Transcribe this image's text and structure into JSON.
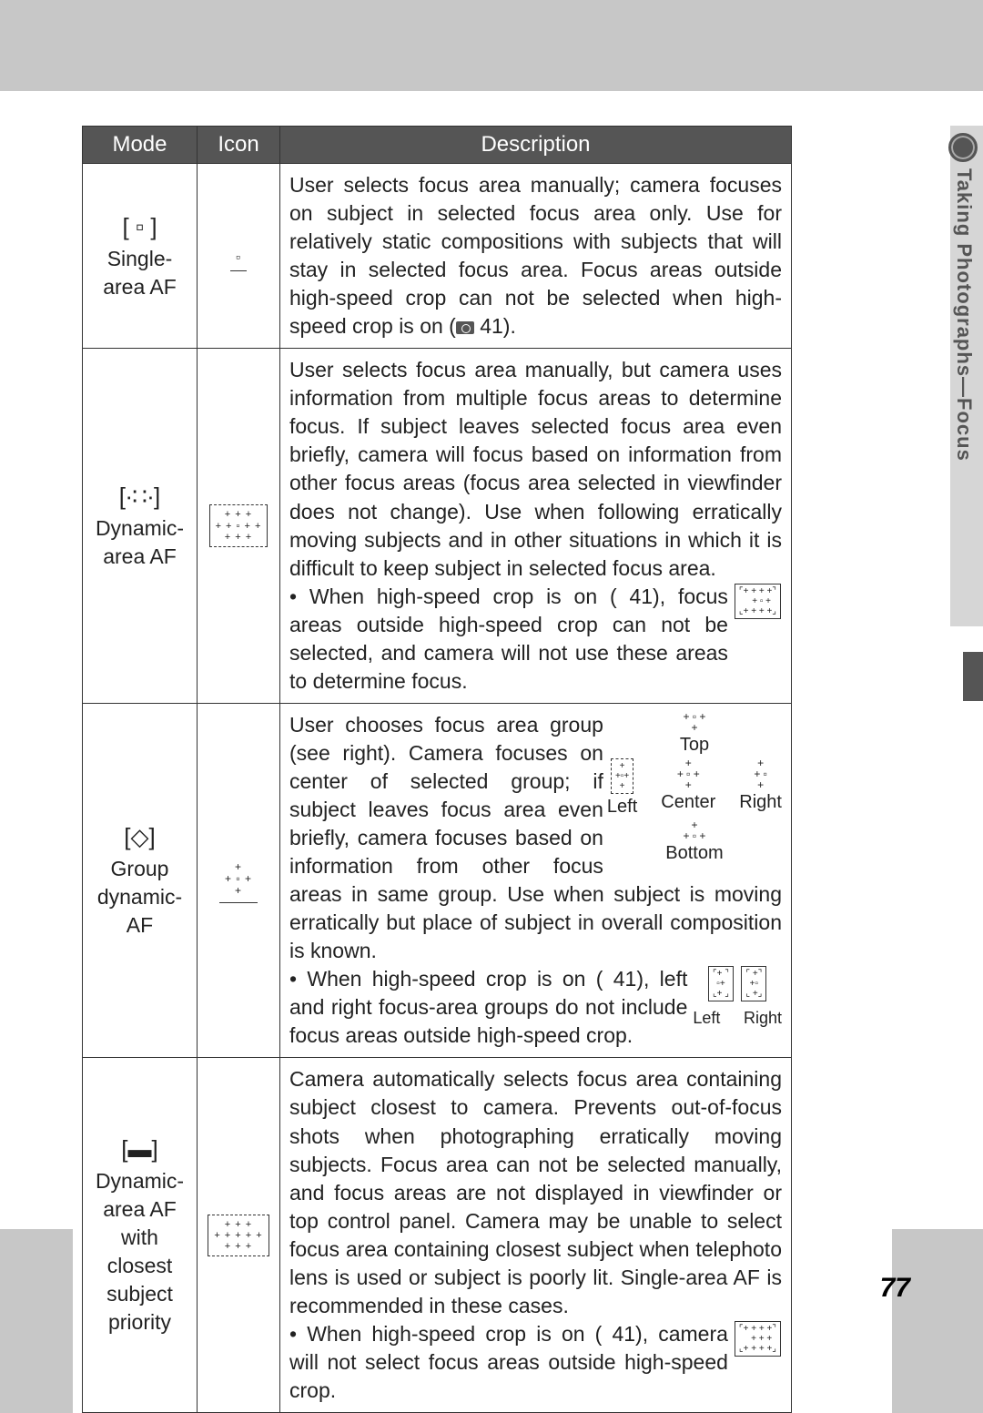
{
  "side": {
    "section_icon": "camera-dial-icon",
    "label": "Taking Photographs—Focus"
  },
  "table": {
    "headers": {
      "mode": "Mode",
      "icon": "Icon",
      "desc": "Description"
    },
    "rows": [
      {
        "mode_glyph": "[ ▫ ]",
        "mode_label": "Single-area AF",
        "icon_art": "▫",
        "desc_main": "User selects focus area manually; camera focuses on subject in selected focus area only.  Use for relatively static compositions with subjects that will stay in selected focus area.  Focus areas outside high-speed crop can not be selected when high-speed crop is on (",
        "desc_ref": " 41)."
      },
      {
        "mode_glyph": "[∙∷∙]",
        "mode_label": "Dynamic-area AF",
        "icon_art": "+ + +\n+ + ▫ + +\n+ + +",
        "desc_main": "User selects focus area manually, but camera uses information from multiple focus areas to determine focus.  If subject leaves selected focus area even briefly, camera will focus based on information from other focus areas (focus area selected in viewfinder does not change).  Use when following erratically moving subjects and in other situations in which it is difficult to keep subject in selected focus area.",
        "bullet_text": "When high-speed crop is on ( 41), focus areas outside high-speed crop can not be selected, and camera will not use these areas to determine focus.",
        "bullet_fig": "⌜+ + + +⌝\n   + ▫ +\n⌞+ + + +⌟"
      },
      {
        "mode_glyph": "[◇]",
        "mode_label": "Group dynamic-AF",
        "icon_art": "+\n+ ▫ +\n+",
        "desc_main": "User chooses focus area group (see right).  Camera focuses on center of selected group; if subject leaves focus area even briefly, camera focuses based on information from other focus areas in same group.  Use when subject is moving erratically but place of subject in overall composition is known.",
        "diagram": {
          "top": "Top",
          "left": "Left",
          "center": "Center",
          "right": "Right",
          "bottom": "Bottom"
        },
        "bullet_text": "When high-speed crop is on ( 41), left and right focus-area groups do not include focus areas outside high-speed crop.",
        "bullet_fig_labels": {
          "left": "Left",
          "right": "Right"
        }
      },
      {
        "mode_glyph": "[▬]",
        "mode_label": "Dynamic-area AF with closest subject priority",
        "icon_art": "+ + +\n+ + + + +\n+ + +",
        "desc_main": "Camera automatically selects focus area containing subject closest to camera.  Prevents out-of-focus shots when photographing erratically moving subjects.  Focus area can not be selected manually, and focus areas are not displayed in viewfinder or top control panel.  Camera may be unable to select focus area containing closest subject when telephoto lens is used or subject is poorly lit.  Single-area AF is recommended in these cases.",
        "bullet_text": "When high-speed crop is on ( 41), camera will not select focus areas outside high-speed crop.",
        "bullet_fig": "⌜+ + + +⌝\n   + + +\n⌞+ + + +⌟"
      }
    ]
  },
  "page_number": "77"
}
